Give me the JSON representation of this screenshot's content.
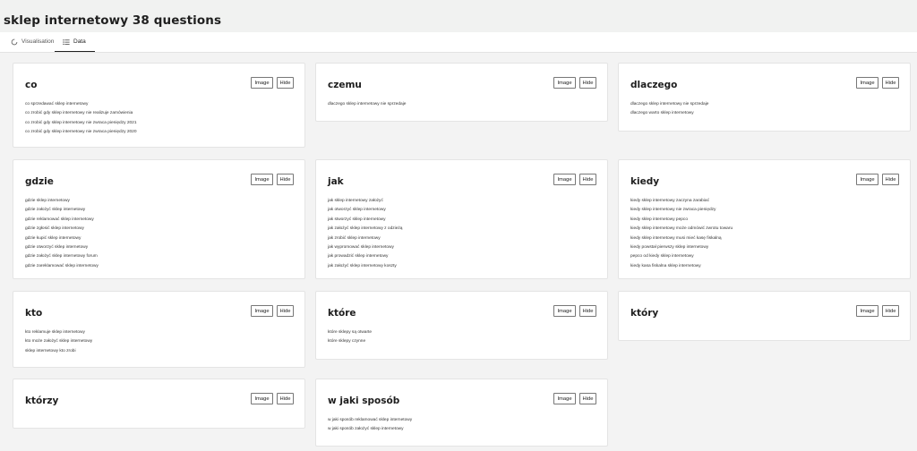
{
  "page": {
    "title": "sklep internetowy 38 questions"
  },
  "tabs": [
    {
      "label": "Visualisation",
      "icon": "circle-refresh-icon",
      "active": false
    },
    {
      "label": "Data",
      "icon": "list-icon",
      "active": true
    }
  ],
  "button_labels": {
    "image": "Image",
    "hide": "Hide"
  },
  "cards": [
    {
      "title": "co",
      "questions": [
        "co sprzedawać sklep internetowy",
        "co zrobić gdy sklep internetowy nie realizuje zamówienia",
        "co zrobić gdy sklep internetowy nie zwraca pieniędzy 2021",
        "co zrobić gdy sklep internetowy nie zwraca pieniędzy 2020"
      ]
    },
    {
      "title": "czemu",
      "questions": [
        "dlaczego sklep internetowy nie sprzedaje"
      ]
    },
    {
      "title": "dlaczego",
      "questions": [
        "dlaczego sklep internetowy nie sprzedaje",
        "dlaczego warto sklep internetowy"
      ]
    },
    {
      "title": "gdzie",
      "questions": [
        "gdzie sklep internetowy",
        "gdzie założyć sklep internetowy",
        "gdzie reklamować sklep internetowy",
        "gdzie zgłosić sklep internetowy",
        "gdzie kupić sklep internetowy",
        "gdzie otworzyć sklep internetowy",
        "gdzie założyć sklep internetowy forum",
        "gdzie zareklamować sklep internetowy"
      ]
    },
    {
      "title": "jak",
      "questions": [
        "jak sklep internetowy założyć",
        "jak otworzyć sklep internetowy",
        "jak stworzyć sklep internetowy",
        "jak założyć sklep internetowy z odzieżą",
        "jak zrobić sklep internetowy",
        "jak wypromować sklep internetowy",
        "jak prowadzić sklep internetowy",
        "jak założyć sklep internetowy koszty"
      ]
    },
    {
      "title": "kiedy",
      "questions": [
        "kiedy sklep internetowy zaczyna zarabiać",
        "kiedy sklep internetowy nie zwraca pieniędzy",
        "kiedy sklep internetowy pepco",
        "kiedy sklep internetowy może odmówić zwrotu towaru",
        "kiedy sklep internetowy musi mieć kasę fiskalną",
        "kiedy powstał pierwszy sklep internetowy",
        "pepco od kiedy sklep internetowy",
        "kiedy kasa fiskalna sklep internetowy"
      ]
    },
    {
      "title": "kto",
      "questions": [
        "kto reklamuje sklep internetowy",
        "kto może założyć sklep internetowy",
        "sklep internetowy kto zrobi"
      ]
    },
    {
      "title": "które",
      "questions": [
        "które sklepy są otwarte",
        "które sklepy czynne"
      ]
    },
    {
      "title": "który",
      "questions": []
    },
    {
      "title": "którzy",
      "questions": []
    },
    {
      "title": "w jaki sposób",
      "questions": [
        "w jaki sposób reklamować sklep internetowy",
        "w jaki sposób założyć sklep internetowy"
      ]
    }
  ]
}
